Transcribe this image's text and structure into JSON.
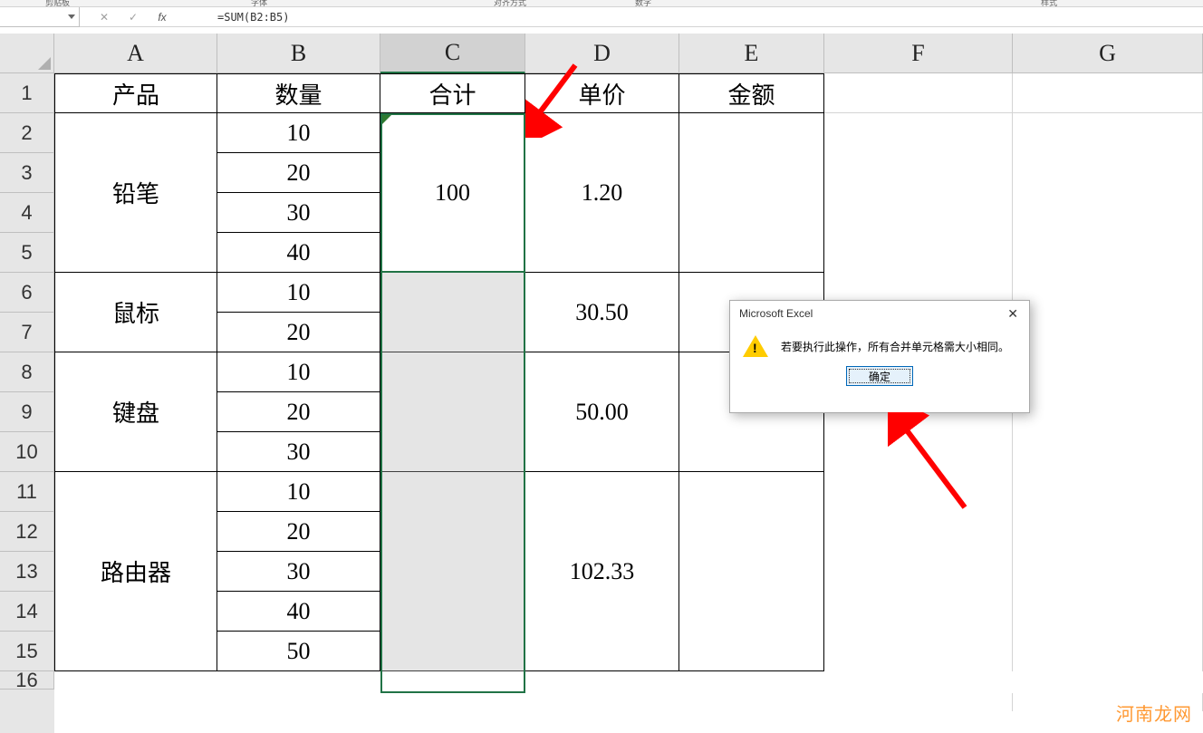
{
  "ribbon": {
    "groups": [
      "剪贴板",
      "字体",
      "对齐方式",
      "数字",
      "样式"
    ]
  },
  "formula_bar": {
    "name_box": "",
    "formula": "=SUM(B2:B5)"
  },
  "columns": [
    "A",
    "B",
    "C",
    "D",
    "E",
    "F",
    "G"
  ],
  "rows": [
    "1",
    "2",
    "3",
    "4",
    "5",
    "6",
    "7",
    "8",
    "9",
    "10",
    "11",
    "12",
    "13",
    "14",
    "15",
    "16"
  ],
  "selected_column": "C",
  "headers": {
    "A1": "产品",
    "B1": "数量",
    "C1": "合计",
    "D1": "单价",
    "E1": "金额"
  },
  "data": {
    "products": [
      {
        "name": "铅笔",
        "qty": [
          "10",
          "20",
          "30",
          "40"
        ],
        "total": "100",
        "price": "1.20"
      },
      {
        "name": "鼠标",
        "qty": [
          "10",
          "20"
        ],
        "total": "",
        "price": "30.50"
      },
      {
        "name": "键盘",
        "qty": [
          "10",
          "20",
          "30"
        ],
        "total": "",
        "price": "50.00"
      },
      {
        "name": "路由器",
        "qty": [
          "10",
          "20",
          "30",
          "40",
          "50"
        ],
        "total": "",
        "price": "102.33"
      }
    ]
  },
  "dialog": {
    "title": "Microsoft Excel",
    "message": "若要执行此操作，所有合并单元格需大小相同。",
    "ok": "确定"
  },
  "watermark": "河南龙网"
}
